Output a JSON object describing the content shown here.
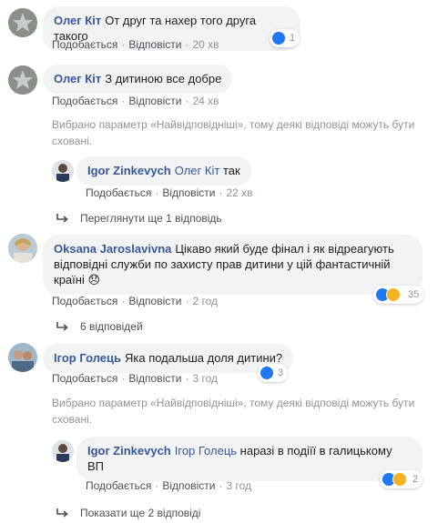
{
  "actions": {
    "like": "Подобається",
    "reply": "Відповісти"
  },
  "comments": [
    {
      "author": "Олег Кіт",
      "text": "От друг та нахер того друга такого",
      "time": "20 хв",
      "reactions": "1"
    },
    {
      "author": "Олег Кіт",
      "text": "З дитиною все добре",
      "time": "24 хв"
    },
    {
      "author": "Oksana Jaroslavivna",
      "text": "Цікаво який буде фінал і як відреагують відповідні служби по захисту прав дитини у цій фантастичній країні 😞",
      "time": "2 год",
      "reactions": "35"
    },
    {
      "author": "Ігор Голець",
      "text": "Яка подальша доля дитини?",
      "time": "3 год",
      "reactions": "3"
    }
  ],
  "replies": [
    {
      "author": "Igor Zinkevych",
      "mention": "Олег Кіт",
      "text": "так",
      "time": "22 хв"
    },
    {
      "author": "Igor Zinkevych",
      "mention": "Ігор Голець",
      "text": "наразі в подіїї в галицькому ВП",
      "time": "3 год",
      "reactions": "2"
    }
  ],
  "notices": {
    "filter_1": "Вибрано параметр «Найвідповідніші», тому деякі відповіді можуть бути сховані.",
    "filter_2": "Вибрано параметр «Найвідповідніші», тому деякі відповіді можуть бути сховані."
  },
  "more_links": {
    "view_one_more": "Переглянути ще 1 відповідь",
    "six_replies": "6 відповідей",
    "show_two_more": "Показати ще 2 відповіді"
  },
  "colors": {
    "link": "#385898",
    "bubble": "#f2f3f5",
    "like_blue": "#2078f4",
    "emoji_yellow": "#f7b125"
  },
  "icons": [
    "avatar-icon",
    "like-reaction-icon",
    "wow-reaction-icon",
    "sad-reaction-icon",
    "reply-arrow-icon"
  ]
}
